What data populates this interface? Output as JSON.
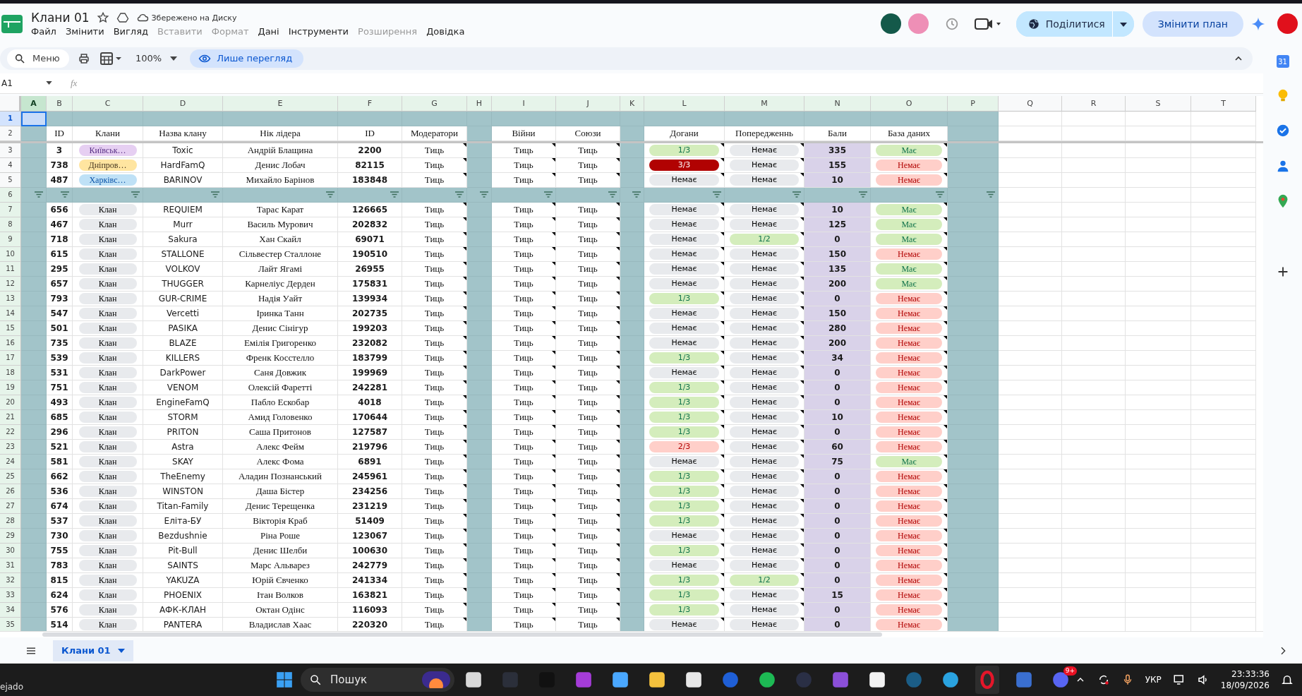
{
  "app": {
    "title": "Клани 01",
    "save_status": "Збережено на Диску",
    "menu": [
      {
        "label": "Файл",
        "disabled": false
      },
      {
        "label": "Змінити",
        "disabled": false
      },
      {
        "label": "Вигляд",
        "disabled": false
      },
      {
        "label": "Вставити",
        "disabled": true
      },
      {
        "label": "Формат",
        "disabled": true
      },
      {
        "label": "Дані",
        "disabled": false
      },
      {
        "label": "Інструменти",
        "disabled": false
      },
      {
        "label": "Розширення",
        "disabled": true
      },
      {
        "label": "Довідка",
        "disabled": false
      }
    ],
    "share_button": "Поділитися",
    "upgrade_button": "Змінити план"
  },
  "toolbar": {
    "search": {
      "placeholder": "Меню"
    },
    "zoom": "100%",
    "view_only": "Лише перегляд"
  },
  "formula_bar": {
    "cell_ref": "A1",
    "fx_label": "fx"
  },
  "side_panel": {
    "calendar_day": "31"
  },
  "sheet": {
    "columns": [
      {
        "label": "A",
        "selected": true,
        "filtered": true
      },
      {
        "label": "B",
        "selected": false,
        "filtered": true
      },
      {
        "label": "C",
        "selected": false,
        "filtered": true
      },
      {
        "label": "D",
        "selected": false,
        "filtered": true
      },
      {
        "label": "E",
        "selected": false,
        "filtered": true
      },
      {
        "label": "F",
        "selected": false,
        "filtered": true
      },
      {
        "label": "G",
        "selected": false,
        "filtered": true
      },
      {
        "label": "H",
        "selected": false,
        "filtered": true
      },
      {
        "label": "I",
        "selected": false,
        "filtered": true
      },
      {
        "label": "J",
        "selected": false,
        "filtered": true
      },
      {
        "label": "K",
        "selected": false,
        "filtered": true
      },
      {
        "label": "L",
        "selected": false,
        "filtered": true
      },
      {
        "label": "M",
        "selected": false,
        "filtered": true
      },
      {
        "label": "N",
        "selected": false,
        "filtered": true
      },
      {
        "label": "O",
        "selected": false,
        "filtered": true
      },
      {
        "label": "P",
        "selected": false,
        "filtered": true
      },
      {
        "label": "Q",
        "selected": false,
        "filtered": false
      },
      {
        "label": "R",
        "selected": false,
        "filtered": false
      },
      {
        "label": "S",
        "selected": false,
        "filtered": false
      },
      {
        "label": "T",
        "selected": false,
        "filtered": false
      }
    ],
    "rows": [
      {
        "kind": "blank",
        "number": "1",
        "selected": true,
        "filtered": false
      },
      {
        "kind": "header",
        "number": "2",
        "selected": false,
        "filtered": false,
        "cells": [
          "ID",
          "Клани",
          "Назва клану",
          "Нік лідера",
          "ID",
          "Модератори",
          "Війни",
          "Союзи",
          "Догани",
          "Попередженнь",
          "Бали",
          "База даних"
        ]
      },
      {
        "kind": "data",
        "number": "3",
        "selected": false,
        "filtered": false,
        "id": "3",
        "clan": {
          "text": "Київськ…",
          "color": "#e6cff2"
        },
        "name": "Toxic",
        "leader": "Андрій Блащина",
        "player_id": "2200",
        "moderators": "Тиць",
        "wars": "Тиць",
        "alliances": "Тиць",
        "reprimands": {
          "text": "1/3",
          "color": "#d4edbc"
        },
        "warnings": {
          "text": "Немає",
          "color": "#e8eaed"
        },
        "points": "335",
        "database": {
          "text": "Має",
          "color": "#d4edbc"
        }
      },
      {
        "kind": "data",
        "number": "4",
        "selected": false,
        "filtered": false,
        "id": "738",
        "clan": {
          "text": "Дніпров…",
          "color": "#ffe5a0"
        },
        "name": "HardFamQ",
        "leader": "Денис Лобач",
        "player_id": "82115",
        "moderators": "Тиць",
        "wars": "Тиць",
        "alliances": "Тиць",
        "reprimands": {
          "text": "3/3",
          "color": "#b10202"
        },
        "warnings": {
          "text": "Немає",
          "color": "#e8eaed"
        },
        "points": "155",
        "database": {
          "text": "Немає",
          "color": "#ffcfc9"
        }
      },
      {
        "kind": "data",
        "number": "5",
        "selected": false,
        "filtered": false,
        "id": "487",
        "clan": {
          "text": "Харківс…",
          "color": "#bfe1f6"
        },
        "name": "BARINOV",
        "leader": "Михайло Барінов",
        "player_id": "183848",
        "moderators": "Тиць",
        "wars": "Тиць",
        "alliances": "Тиць",
        "reprimands": {
          "text": "Немає",
          "color": "#e8eaed"
        },
        "warnings": {
          "text": "Немає",
          "color": "#e8eaed"
        },
        "points": "10",
        "database": {
          "text": "Немає",
          "color": "#ffcfc9"
        }
      },
      {
        "kind": "filter",
        "number": "6",
        "selected": false,
        "filtered": true
      },
      {
        "kind": "data",
        "number": "7",
        "selected": false,
        "filtered": true,
        "id": "656",
        "clan": {
          "text": "Клан",
          "color": "#e8eaed"
        },
        "name": "REQUIEM",
        "leader": "Тарас Карат",
        "player_id": "126665",
        "moderators": "Тиць",
        "wars": "Тиць",
        "alliances": "Тиць",
        "reprimands": {
          "text": "Немає",
          "color": "#e8eaed"
        },
        "warnings": {
          "text": "Немає",
          "color": "#e8eaed"
        },
        "points": "10",
        "database": {
          "text": "Має",
          "color": "#d4edbc"
        }
      },
      {
        "kind": "data",
        "number": "8",
        "selected": false,
        "filtered": true,
        "id": "467",
        "clan": {
          "text": "Клан",
          "color": "#e8eaed"
        },
        "name": "Murr",
        "leader": "Василь Мурович",
        "player_id": "202832",
        "moderators": "Тиць",
        "wars": "Тиць",
        "alliances": "Тиць",
        "reprimands": {
          "text": "Немає",
          "color": "#e8eaed"
        },
        "warnings": {
          "text": "Немає",
          "color": "#e8eaed"
        },
        "points": "125",
        "database": {
          "text": "Має",
          "color": "#d4edbc"
        }
      },
      {
        "kind": "data",
        "number": "9",
        "selected": false,
        "filtered": true,
        "id": "718",
        "clan": {
          "text": "Клан",
          "color": "#e8eaed"
        },
        "name": "Sakura",
        "leader": "Хан Скайл",
        "player_id": "69071",
        "moderators": "Тиць",
        "wars": "Тиць",
        "alliances": "Тиць",
        "reprimands": {
          "text": "Немає",
          "color": "#e8eaed"
        },
        "warnings": {
          "text": "1/2",
          "color": "#d4edbc"
        },
        "points": "0",
        "database": {
          "text": "Має",
          "color": "#d4edbc"
        }
      },
      {
        "kind": "data",
        "number": "10",
        "selected": false,
        "filtered": true,
        "id": "615",
        "clan": {
          "text": "Клан",
          "color": "#e8eaed"
        },
        "name": "STALLONE",
        "leader": "Сільвестер Сталлоне",
        "player_id": "190510",
        "moderators": "Тиць",
        "wars": "Тиць",
        "alliances": "Тиць",
        "reprimands": {
          "text": "Немає",
          "color": "#e8eaed"
        },
        "warnings": {
          "text": "Немає",
          "color": "#e8eaed"
        },
        "points": "150",
        "database": {
          "text": "Немає",
          "color": "#ffcfc9"
        }
      },
      {
        "kind": "data",
        "number": "11",
        "selected": false,
        "filtered": true,
        "id": "295",
        "clan": {
          "text": "Клан",
          "color": "#e8eaed"
        },
        "name": "VOLKOV",
        "leader": "Лайт Ягамі",
        "player_id": "26955",
        "moderators": "Тиць",
        "wars": "Тиць",
        "alliances": "Тиць",
        "reprimands": {
          "text": "Немає",
          "color": "#e8eaed"
        },
        "warnings": {
          "text": "Немає",
          "color": "#e8eaed"
        },
        "points": "135",
        "database": {
          "text": "Має",
          "color": "#d4edbc"
        }
      },
      {
        "kind": "data",
        "number": "12",
        "selected": false,
        "filtered": true,
        "id": "657",
        "clan": {
          "text": "Клан",
          "color": "#e8eaed"
        },
        "name": "THUGGER",
        "leader": "Карнеліус Дерден",
        "player_id": "175831",
        "moderators": "Тиць",
        "wars": "Тиць",
        "alliances": "Тиць",
        "reprimands": {
          "text": "Немає",
          "color": "#e8eaed"
        },
        "warnings": {
          "text": "Немає",
          "color": "#e8eaed"
        },
        "points": "200",
        "database": {
          "text": "Має",
          "color": "#d4edbc"
        }
      },
      {
        "kind": "data",
        "number": "13",
        "selected": false,
        "filtered": true,
        "id": "793",
        "clan": {
          "text": "Клан",
          "color": "#e8eaed"
        },
        "name": "GUR-CRIME",
        "leader": "Надія Уайт",
        "player_id": "139934",
        "moderators": "Тиць",
        "wars": "Тиць",
        "alliances": "Тиць",
        "reprimands": {
          "text": "1/3",
          "color": "#d4edbc"
        },
        "warnings": {
          "text": "Немає",
          "color": "#e8eaed"
        },
        "points": "0",
        "database": {
          "text": "Немає",
          "color": "#ffcfc9"
        }
      },
      {
        "kind": "data",
        "number": "14",
        "selected": false,
        "filtered": true,
        "id": "547",
        "clan": {
          "text": "Клан",
          "color": "#e8eaed"
        },
        "name": "Vercetti",
        "leader": "Іринка Танн",
        "player_id": "202735",
        "moderators": "Тиць",
        "wars": "Тиць",
        "alliances": "Тиць",
        "reprimands": {
          "text": "Немає",
          "color": "#e8eaed"
        },
        "warnings": {
          "text": "Немає",
          "color": "#e8eaed"
        },
        "points": "150",
        "database": {
          "text": "Немає",
          "color": "#ffcfc9"
        }
      },
      {
        "kind": "data",
        "number": "15",
        "selected": false,
        "filtered": true,
        "id": "501",
        "clan": {
          "text": "Клан",
          "color": "#e8eaed"
        },
        "name": "PASIKA",
        "leader": "Денис Сінігур",
        "player_id": "199203",
        "moderators": "Тиць",
        "wars": "Тиць",
        "alliances": "Тиць",
        "reprimands": {
          "text": "Немає",
          "color": "#e8eaed"
        },
        "warnings": {
          "text": "Немає",
          "color": "#e8eaed"
        },
        "points": "280",
        "database": {
          "text": "Немає",
          "color": "#ffcfc9"
        }
      },
      {
        "kind": "data",
        "number": "16",
        "selected": false,
        "filtered": true,
        "id": "735",
        "clan": {
          "text": "Клан",
          "color": "#e8eaed"
        },
        "name": "BLAZE",
        "leader": "Емілія Григоренко",
        "player_id": "232082",
        "moderators": "Тиць",
        "wars": "Тиць",
        "alliances": "Тиць",
        "reprimands": {
          "text": "Немає",
          "color": "#e8eaed"
        },
        "warnings": {
          "text": "Немає",
          "color": "#e8eaed"
        },
        "points": "200",
        "database": {
          "text": "Немає",
          "color": "#ffcfc9"
        }
      },
      {
        "kind": "data",
        "number": "17",
        "selected": false,
        "filtered": true,
        "id": "539",
        "clan": {
          "text": "Клан",
          "color": "#e8eaed"
        },
        "name": "KILLERS",
        "leader": "Френк Косстелло",
        "player_id": "183799",
        "moderators": "Тиць",
        "wars": "Тиць",
        "alliances": "Тиць",
        "reprimands": {
          "text": "1/3",
          "color": "#d4edbc"
        },
        "warnings": {
          "text": "Немає",
          "color": "#e8eaed"
        },
        "points": "34",
        "database": {
          "text": "Немає",
          "color": "#ffcfc9"
        }
      },
      {
        "kind": "data",
        "number": "18",
        "selected": false,
        "filtered": true,
        "id": "531",
        "clan": {
          "text": "Клан",
          "color": "#e8eaed"
        },
        "name": "DarkPower",
        "leader": "Саня Довжик",
        "player_id": "199969",
        "moderators": "Тиць",
        "wars": "Тиць",
        "alliances": "Тиць",
        "reprimands": {
          "text": "Немає",
          "color": "#e8eaed"
        },
        "warnings": {
          "text": "Немає",
          "color": "#e8eaed"
        },
        "points": "0",
        "database": {
          "text": "Немає",
          "color": "#ffcfc9"
        }
      },
      {
        "kind": "data",
        "number": "19",
        "selected": false,
        "filtered": true,
        "id": "751",
        "clan": {
          "text": "Клан",
          "color": "#e8eaed"
        },
        "name": "VENOM",
        "leader": "Олексій Фаретті",
        "player_id": "242281",
        "moderators": "Тиць",
        "wars": "Тиць",
        "alliances": "Тиць",
        "reprimands": {
          "text": "1/3",
          "color": "#d4edbc"
        },
        "warnings": {
          "text": "Немає",
          "color": "#e8eaed"
        },
        "points": "0",
        "database": {
          "text": "Немає",
          "color": "#ffcfc9"
        }
      },
      {
        "kind": "data",
        "number": "20",
        "selected": false,
        "filtered": true,
        "id": "493",
        "clan": {
          "text": "Клан",
          "color": "#e8eaed"
        },
        "name": "EngineFamQ",
        "leader": "Пабло Ескобар",
        "player_id": "4018",
        "moderators": "Тиць",
        "wars": "Тиць",
        "alliances": "Тиць",
        "reprimands": {
          "text": "1/3",
          "color": "#d4edbc"
        },
        "warnings": {
          "text": "Немає",
          "color": "#e8eaed"
        },
        "points": "0",
        "database": {
          "text": "Немає",
          "color": "#ffcfc9"
        }
      },
      {
        "kind": "data",
        "number": "21",
        "selected": false,
        "filtered": true,
        "id": "685",
        "clan": {
          "text": "Клан",
          "color": "#e8eaed"
        },
        "name": "STORM",
        "leader": "Амид Головенко",
        "player_id": "170644",
        "moderators": "Тиць",
        "wars": "Тиць",
        "alliances": "Тиць",
        "reprimands": {
          "text": "1/3",
          "color": "#d4edbc"
        },
        "warnings": {
          "text": "Немає",
          "color": "#e8eaed"
        },
        "points": "10",
        "database": {
          "text": "Немає",
          "color": "#ffcfc9"
        }
      },
      {
        "kind": "data",
        "number": "22",
        "selected": false,
        "filtered": true,
        "id": "296",
        "clan": {
          "text": "Клан",
          "color": "#e8eaed"
        },
        "name": "PRITON",
        "leader": "Саша Притонов",
        "player_id": "127587",
        "moderators": "Тиць",
        "wars": "Тиць",
        "alliances": "Тиць",
        "reprimands": {
          "text": "1/3",
          "color": "#d4edbc"
        },
        "warnings": {
          "text": "Немає",
          "color": "#e8eaed"
        },
        "points": "0",
        "database": {
          "text": "Немає",
          "color": "#ffcfc9"
        }
      },
      {
        "kind": "data",
        "number": "23",
        "selected": false,
        "filtered": true,
        "id": "521",
        "clan": {
          "text": "Клан",
          "color": "#e8eaed"
        },
        "name": "Astra",
        "leader": "Алекс Фейм",
        "player_id": "219796",
        "moderators": "Тиць",
        "wars": "Тиць",
        "alliances": "Тиць",
        "reprimands": {
          "text": "2/3",
          "color": "#ffcfc9"
        },
        "warnings": {
          "text": "Немає",
          "color": "#e8eaed"
        },
        "points": "60",
        "database": {
          "text": "Немає",
          "color": "#ffcfc9"
        }
      },
      {
        "kind": "data",
        "number": "24",
        "selected": false,
        "filtered": true,
        "id": "581",
        "clan": {
          "text": "Клан",
          "color": "#e8eaed"
        },
        "name": "SKAY",
        "leader": "Алекс Фома",
        "player_id": "6891",
        "moderators": "Тиць",
        "wars": "Тиць",
        "alliances": "Тиць",
        "reprimands": {
          "text": "Немає",
          "color": "#e8eaed"
        },
        "warnings": {
          "text": "Немає",
          "color": "#e8eaed"
        },
        "points": "75",
        "database": {
          "text": "Має",
          "color": "#d4edbc"
        }
      },
      {
        "kind": "data",
        "number": "25",
        "selected": false,
        "filtered": true,
        "id": "662",
        "clan": {
          "text": "Клан",
          "color": "#e8eaed"
        },
        "name": "TheEnemy",
        "leader": "Аладин Познанський",
        "player_id": "245961",
        "moderators": "Тиць",
        "wars": "Тиць",
        "alliances": "Тиць",
        "reprimands": {
          "text": "1/3",
          "color": "#d4edbc"
        },
        "warnings": {
          "text": "Немає",
          "color": "#e8eaed"
        },
        "points": "0",
        "database": {
          "text": "Немає",
          "color": "#ffcfc9"
        }
      },
      {
        "kind": "data",
        "number": "26",
        "selected": false,
        "filtered": true,
        "id": "536",
        "clan": {
          "text": "Клан",
          "color": "#e8eaed"
        },
        "name": "WINSTON",
        "leader": "Даша Бістер",
        "player_id": "234256",
        "moderators": "Тиць",
        "wars": "Тиць",
        "alliances": "Тиць",
        "reprimands": {
          "text": "1/3",
          "color": "#d4edbc"
        },
        "warnings": {
          "text": "Немає",
          "color": "#e8eaed"
        },
        "points": "0",
        "database": {
          "text": "Немає",
          "color": "#ffcfc9"
        }
      },
      {
        "kind": "data",
        "number": "27",
        "selected": false,
        "filtered": true,
        "id": "674",
        "clan": {
          "text": "Клан",
          "color": "#e8eaed"
        },
        "name": "Titan-Family",
        "leader": "Денис Терещенка",
        "player_id": "231219",
        "moderators": "Тиць",
        "wars": "Тиць",
        "alliances": "Тиць",
        "reprimands": {
          "text": "1/3",
          "color": "#d4edbc"
        },
        "warnings": {
          "text": "Немає",
          "color": "#e8eaed"
        },
        "points": "0",
        "database": {
          "text": "Немає",
          "color": "#ffcfc9"
        }
      },
      {
        "kind": "data",
        "number": "28",
        "selected": false,
        "filtered": true,
        "id": "537",
        "clan": {
          "text": "Клан",
          "color": "#e8eaed"
        },
        "name": "Еліта-БУ",
        "leader": "Вікторія Краб",
        "player_id": "51409",
        "moderators": "Тиць",
        "wars": "Тиць",
        "alliances": "Тиць",
        "reprimands": {
          "text": "1/3",
          "color": "#d4edbc"
        },
        "warnings": {
          "text": "Немає",
          "color": "#e8eaed"
        },
        "points": "0",
        "database": {
          "text": "Немає",
          "color": "#ffcfc9"
        }
      },
      {
        "kind": "data",
        "number": "29",
        "selected": false,
        "filtered": true,
        "id": "730",
        "clan": {
          "text": "Клан",
          "color": "#e8eaed"
        },
        "name": "Bezdushnie",
        "leader": "Ріна Роше",
        "player_id": "123067",
        "moderators": "Тиць",
        "wars": "Тиць",
        "alliances": "Тиць",
        "reprimands": {
          "text": "Немає",
          "color": "#e8eaed"
        },
        "warnings": {
          "text": "Немає",
          "color": "#e8eaed"
        },
        "points": "0",
        "database": {
          "text": "Немає",
          "color": "#ffcfc9"
        }
      },
      {
        "kind": "data",
        "number": "30",
        "selected": false,
        "filtered": true,
        "id": "755",
        "clan": {
          "text": "Клан",
          "color": "#e8eaed"
        },
        "name": "Pit-Bull",
        "leader": "Денис Шелби",
        "player_id": "100630",
        "moderators": "Тиць",
        "wars": "Тиць",
        "alliances": "Тиць",
        "reprimands": {
          "text": "1/3",
          "color": "#d4edbc"
        },
        "warnings": {
          "text": "Немає",
          "color": "#e8eaed"
        },
        "points": "0",
        "database": {
          "text": "Немає",
          "color": "#ffcfc9"
        }
      },
      {
        "kind": "data",
        "number": "31",
        "selected": false,
        "filtered": true,
        "id": "783",
        "clan": {
          "text": "Клан",
          "color": "#e8eaed"
        },
        "name": "SAINTS",
        "leader": "Марс Альварез",
        "player_id": "242779",
        "moderators": "Тиць",
        "wars": "Тиць",
        "alliances": "Тиць",
        "reprimands": {
          "text": "Немає",
          "color": "#e8eaed"
        },
        "warnings": {
          "text": "Немає",
          "color": "#e8eaed"
        },
        "points": "0",
        "database": {
          "text": "Немає",
          "color": "#ffcfc9"
        }
      },
      {
        "kind": "data",
        "number": "32",
        "selected": false,
        "filtered": true,
        "id": "815",
        "clan": {
          "text": "Клан",
          "color": "#e8eaed"
        },
        "name": "YAKUZA",
        "leader": "Юрій Євченко",
        "player_id": "241334",
        "moderators": "Тиць",
        "wars": "Тиць",
        "alliances": "Тиць",
        "reprimands": {
          "text": "1/3",
          "color": "#d4edbc"
        },
        "warnings": {
          "text": "1/2",
          "color": "#d4edbc"
        },
        "points": "0",
        "database": {
          "text": "Немає",
          "color": "#ffcfc9"
        }
      },
      {
        "kind": "data",
        "number": "33",
        "selected": false,
        "filtered": true,
        "id": "624",
        "clan": {
          "text": "Клан",
          "color": "#e8eaed"
        },
        "name": "PHOENIX",
        "leader": "Ітан Волков",
        "player_id": "163821",
        "moderators": "Тиць",
        "wars": "Тиць",
        "alliances": "Тиць",
        "reprimands": {
          "text": "1/3",
          "color": "#d4edbc"
        },
        "warnings": {
          "text": "Немає",
          "color": "#e8eaed"
        },
        "points": "15",
        "database": {
          "text": "Немає",
          "color": "#ffcfc9"
        }
      },
      {
        "kind": "data",
        "number": "34",
        "selected": false,
        "filtered": true,
        "id": "576",
        "clan": {
          "text": "Клан",
          "color": "#e8eaed"
        },
        "name": "АФК-КЛАН",
        "leader": "Октан Одінс",
        "player_id": "116093",
        "moderators": "Тиць",
        "wars": "Тиць",
        "alliances": "Тиць",
        "reprimands": {
          "text": "1/3",
          "color": "#d4edbc"
        },
        "warnings": {
          "text": "Немає",
          "color": "#e8eaed"
        },
        "points": "0",
        "database": {
          "text": "Немає",
          "color": "#ffcfc9"
        }
      },
      {
        "kind": "data",
        "number": "35",
        "selected": false,
        "filtered": true,
        "id": "514",
        "clan": {
          "text": "Клан",
          "color": "#e8eaed"
        },
        "name": "PANTERA",
        "leader": "Владислав Хаас",
        "player_id": "220320",
        "moderators": "Тиць",
        "wars": "Тиць",
        "alliances": "Тиць",
        "reprimands": {
          "text": "Немає",
          "color": "#e8eaed"
        },
        "warnings": {
          "text": "Немає",
          "color": "#e8eaed"
        },
        "points": "0",
        "database": {
          "text": "Немає",
          "color": "#ffcfc9"
        }
      }
    ]
  },
  "sheet_tabs": [
    {
      "label": "Клани 01",
      "selected": true
    }
  ],
  "taskbar": {
    "weather_text": "ejado",
    "search": {
      "placeholder": "Пошук"
    },
    "badge": "9+",
    "language": "УКР",
    "time": "23:33:36",
    "date": "18/09/2026"
  }
}
